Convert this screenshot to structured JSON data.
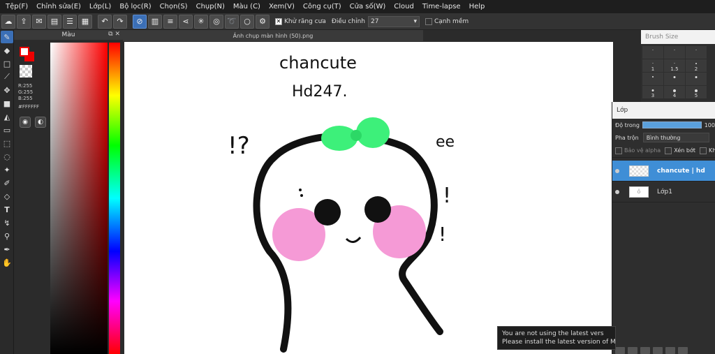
{
  "menu": [
    "Tệp(F)",
    "Chỉnh sửa(E)",
    "Lớp(L)",
    "Bộ lọc(R)",
    "Chọn(S)",
    "Chụp(N)",
    "Màu (C)",
    "Xem(V)",
    "Công cụ(T)",
    "Cửa số(W)",
    "Cloud",
    "Time-lapse",
    "Help"
  ],
  "toolbar": {
    "antialias_label": "Khử răng cưa",
    "adjust_label": "Điều chỉnh",
    "adjust_value": "27",
    "soft_edge_label": "Cạnh mềm"
  },
  "color_panel": {
    "title": "Màu",
    "r": "R:255",
    "g": "G:255",
    "b": "B:255",
    "hex": "#FFFFFF"
  },
  "document": {
    "tab_title": "Ảnh chụp màn hình (50).png",
    "drawing_text_1": "chancute",
    "drawing_text_2": "Hd247.",
    "drawing_marks_left": "!?",
    "drawing_marks_right_top": "ee",
    "drawing_mark_excl": "!"
  },
  "brush_panel": {
    "title": "Brush Size",
    "sizes": [
      ".",
      ".",
      ".",
      "1",
      "1.5",
      "2",
      ".",
      ".",
      ".",
      "3",
      "4",
      "5"
    ]
  },
  "layer_panel": {
    "title": "Lớp",
    "opacity_label": "Độ trong",
    "opacity_value": "100",
    "blend_label": "Pha trộn",
    "blend_value": "Bình thường",
    "protect_alpha": "Bảo vệ alpha",
    "clipping": "Xén bớt",
    "lock": "Kh",
    "layers": [
      {
        "name": "chancute | hd",
        "selected": true
      },
      {
        "name": "Lớp1",
        "selected": false
      }
    ]
  },
  "notice": {
    "line1": "You are not using the latest vers",
    "line2": "Please install the latest version of M"
  }
}
